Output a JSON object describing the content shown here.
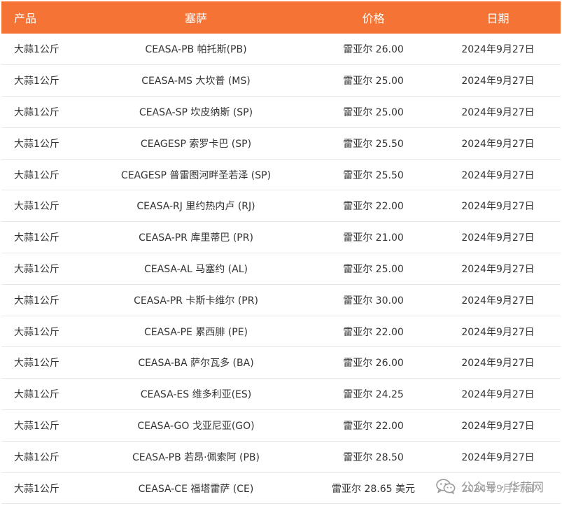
{
  "table": {
    "headers": {
      "product": "产品",
      "region": "塞萨",
      "price": "价格",
      "date": "日期"
    },
    "rows": [
      {
        "product": "大蒜1公斤",
        "region": "CEASA-PB 帕托斯(PB)",
        "price": "雷亚尔 26.00",
        "date": "2024年9月27日"
      },
      {
        "product": "大蒜1公斤",
        "region": "CEASA-MS 大坎普 (MS)",
        "price": "雷亚尔 25.00",
        "date": "2024年9月27日"
      },
      {
        "product": "大蒜1公斤",
        "region": "CEASA-SP 坎皮纳斯 (SP)",
        "price": "雷亚尔 25.00",
        "date": "2024年9月27日"
      },
      {
        "product": "大蒜1公斤",
        "region": "CEAGESP 索罗卡巴 (SP)",
        "price": "雷亚尔 25.50",
        "date": "2024年9月27日"
      },
      {
        "product": "大蒜1公斤",
        "region": "CEAGESP 普雷图河畔圣若泽 (SP)",
        "price": "雷亚尔 25.50",
        "date": "2024年9月27日"
      },
      {
        "product": "大蒜1公斤",
        "region": "CEASA-RJ 里约热内卢 (RJ)",
        "price": "雷亚尔 22.00",
        "date": "2024年9月27日"
      },
      {
        "product": "大蒜1公斤",
        "region": "CEASA-PR 库里蒂巴 (PR)",
        "price": "雷亚尔 21.00",
        "date": "2024年9月27日"
      },
      {
        "product": "大蒜1公斤",
        "region": "CEASA-AL 马塞约 (AL)",
        "price": "雷亚尔 25.00",
        "date": "2024年9月27日"
      },
      {
        "product": "大蒜1公斤",
        "region": "CEASA-PR 卡斯卡维尔 (PR)",
        "price": "雷亚尔 30.00",
        "date": "2024年9月27日"
      },
      {
        "product": "大蒜1公斤",
        "region": "CEASA-PE 累西腓 (PE)",
        "price": "雷亚尔 22.00",
        "date": "2024年9月27日"
      },
      {
        "product": "大蒜1公斤",
        "region": "CEASA-BA 萨尔瓦多 (BA)",
        "price": "雷亚尔 26.00",
        "date": "2024年9月27日"
      },
      {
        "product": "大蒜1公斤",
        "region": "CEASA-ES 维多利亚(ES)",
        "price": "雷亚尔 24.25",
        "date": "2024年9月27日"
      },
      {
        "product": "大蒜1公斤",
        "region": "CEASA-GO 戈亚尼亚(GO)",
        "price": "雷亚尔 22.00",
        "date": "2024年9月27日"
      },
      {
        "product": "大蒜1公斤",
        "region": "CEASA-PB 若昂·佩索阿 (PB)",
        "price": "雷亚尔 28.50",
        "date": "2024年9月27日"
      },
      {
        "product": "大蒜1公斤",
        "region": "CEASA-CE 福塔雷萨 (CE)",
        "price": "雷亚尔 28.65 美元",
        "date": "2024年9月27日"
      }
    ]
  },
  "watermark": {
    "text": "公众号 · 华蒜网",
    "icon": "wechat-icon"
  },
  "colors": {
    "header_bg": "#f47335",
    "header_text": "#ffffff",
    "row_border": "#e8e8e8",
    "body_text": "#333333"
  }
}
